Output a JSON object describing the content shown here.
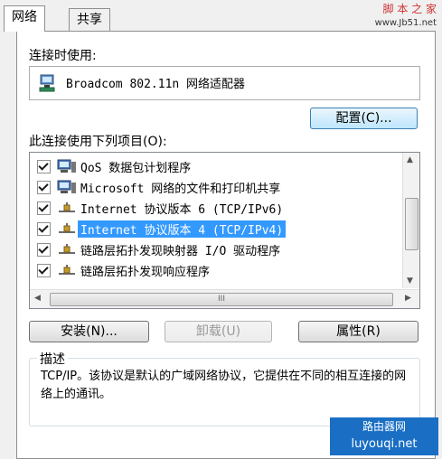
{
  "tabs": [
    {
      "label": "网络",
      "active": true
    },
    {
      "label": "共享",
      "active": false
    }
  ],
  "watermark_top": {
    "title": "脚 本 之 家",
    "url": "www.Jb51.net"
  },
  "connect_using_label": "连接时使用:",
  "adapter": {
    "name": "Broadcom 802.11n 网络适配器",
    "icon": "network-adapter-icon"
  },
  "configure_button": "配置(C)...",
  "items_label": "此连接使用下列项目(O):",
  "items": [
    {
      "label": "QoS 数据包计划程序",
      "checked": true,
      "icon": "computer-icon"
    },
    {
      "label": "Microsoft 网络的文件和打印机共享",
      "checked": true,
      "icon": "computer-icon"
    },
    {
      "label": "Internet 协议版本 6 (TCP/IPv6)",
      "checked": true,
      "icon": "protocol-icon"
    },
    {
      "label": "Internet 协议版本 4 (TCP/IPv4)",
      "checked": true,
      "icon": "protocol-icon",
      "selected": true
    },
    {
      "label": "链路层拓扑发现映射器 I/O 驱动程序",
      "checked": true,
      "icon": "protocol-icon"
    },
    {
      "label": "链路层拓扑发现响应程序",
      "checked": true,
      "icon": "protocol-icon"
    }
  ],
  "hscroll_grip": "III",
  "buttons": {
    "install": "安装(N)...",
    "uninstall": "卸载(U)",
    "properties": "属性(R)"
  },
  "description": {
    "legend": "描述",
    "text": "TCP/IP。该协议是默认的广域网络协议，它提供在不同的相互连接的网络上的通讯。"
  },
  "watermark_bottom": {
    "line1": "路由器网",
    "line2": "luyouqi.net"
  },
  "colors": {
    "selection": "#3399ff",
    "watermark": "#1a6fc4"
  }
}
